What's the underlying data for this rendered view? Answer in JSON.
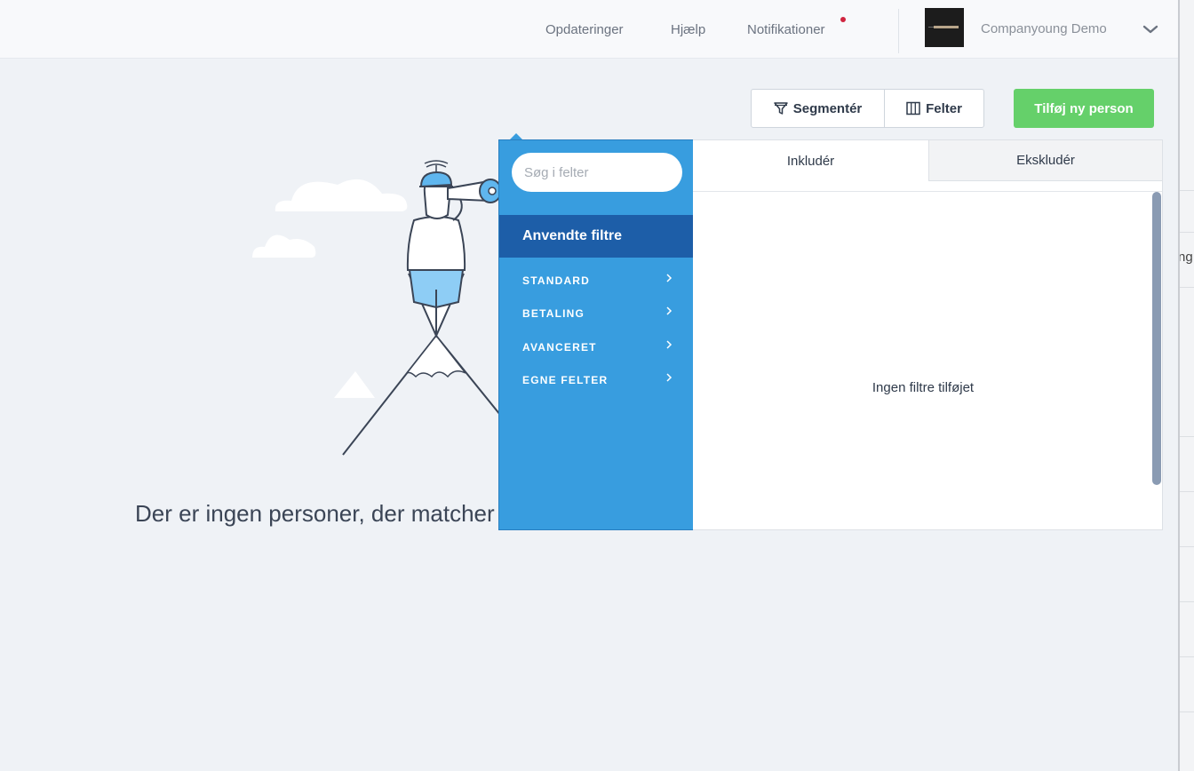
{
  "topbar": {
    "updates": "Opdateringer",
    "help": "Hjælp",
    "notifications": "Notifikationer",
    "company": "Companyoung Demo"
  },
  "actions": {
    "segment": "Segmentér",
    "fields": "Felter",
    "add_person": "Tilføj ny person"
  },
  "empty_state": {
    "message": "Der er ingen personer, der matcher"
  },
  "filter_panel": {
    "search_placeholder": "Søg i felter",
    "applied": "Anvendte filtre",
    "categories": [
      "STANDARD",
      "BETALING",
      "AVANCERET",
      "EGNE FELTER"
    ],
    "tabs": {
      "include": "Inkludér",
      "exclude": "Ekskludér"
    },
    "no_filters": "Ingen filtre tilføjet"
  },
  "background_peek": "ng",
  "colors": {
    "primary_blue": "#389ddf",
    "active_blue": "#1d5ea8",
    "add_green": "#65d06a",
    "notif_red": "#d0243f"
  }
}
